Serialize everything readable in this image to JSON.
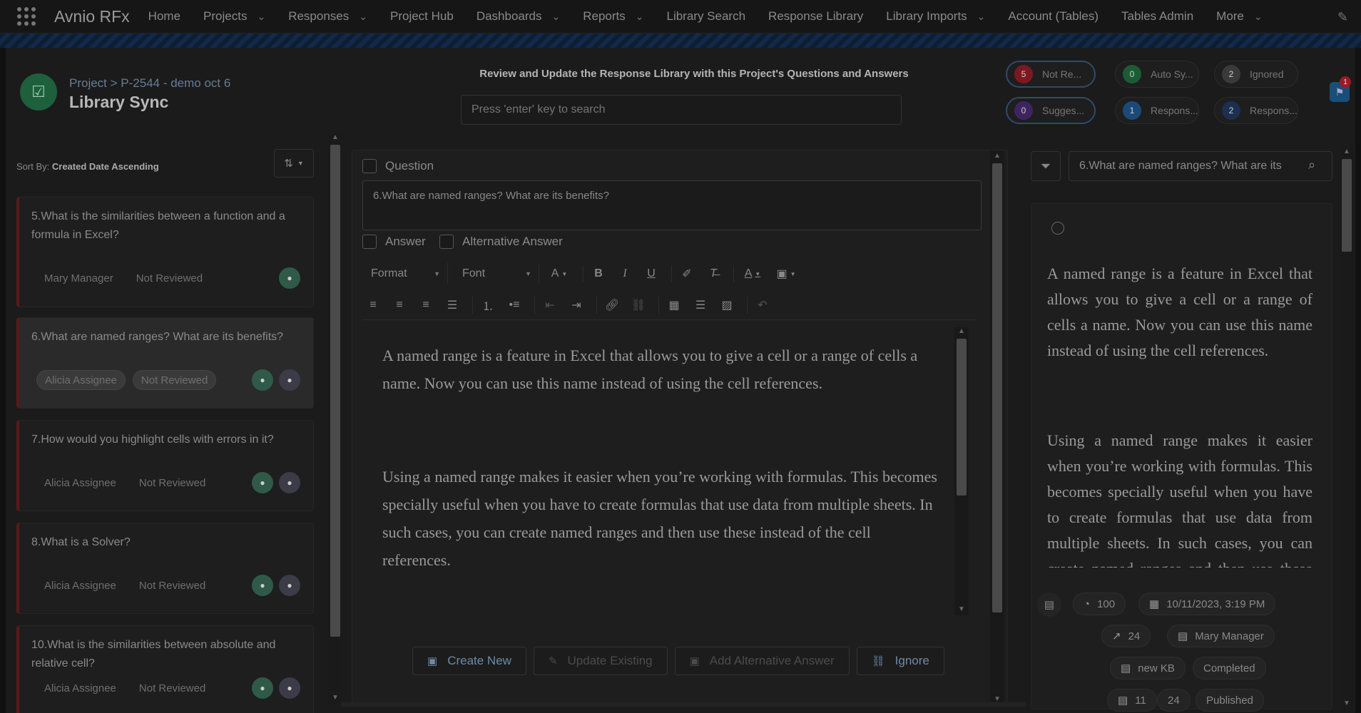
{
  "nav": {
    "app_name": "Avnio RFx",
    "items": [
      {
        "label": "Home",
        "dropdown": false
      },
      {
        "label": "Projects",
        "dropdown": true
      },
      {
        "label": "Responses",
        "dropdown": true
      },
      {
        "label": "Project Hub",
        "dropdown": false
      },
      {
        "label": "Dashboards",
        "dropdown": true
      },
      {
        "label": "Reports",
        "dropdown": true
      },
      {
        "label": "Library Search",
        "dropdown": false
      },
      {
        "label": "Response Library",
        "dropdown": false
      },
      {
        "label": "Library Imports",
        "dropdown": true
      },
      {
        "label": "Account (Tables)",
        "dropdown": false
      },
      {
        "label": "Tables Admin",
        "dropdown": false
      },
      {
        "label": "More",
        "dropdown": true
      }
    ]
  },
  "header": {
    "breadcrumb": "Project > P-2544 - demo oct 6",
    "title": "Library Sync",
    "center_title": "Review and Update the Response Library with this Project's Questions and Answers",
    "search_placeholder": "Press 'enter' key to search",
    "notification_count": "1"
  },
  "status_pills": [
    {
      "count": "5",
      "label": "Not Re...",
      "color": "#7a1a20",
      "active": true
    },
    {
      "count": "0",
      "label": "Auto Sy...",
      "color": "#1b5c34",
      "active": false
    },
    {
      "count": "2",
      "label": "Ignored",
      "color": "#3a3a3a",
      "active": false
    },
    {
      "count": "0",
      "label": "Sugges...",
      "color": "#3f2560",
      "active": true
    },
    {
      "count": "1",
      "label": "Respons...",
      "color": "#1b4a78",
      "active": false
    },
    {
      "count": "2",
      "label": "Respons...",
      "color": "#1b3050",
      "active": false
    }
  ],
  "left_panel": {
    "sort_prefix": "Sort By:",
    "sort_value": "Created Date Ascending",
    "questions": [
      {
        "text": "5.What is the similarities between a function and a formula in Excel?",
        "assignee": "Mary Manager",
        "status": "Not Reviewed",
        "avatars": [
          "f"
        ],
        "selected": false
      },
      {
        "text": "6.What are named ranges? What are its benefits?",
        "assignee": "Alicia Assignee",
        "status": "Not Reviewed",
        "avatars": [
          "f",
          "m"
        ],
        "selected": true
      },
      {
        "text": "7.How would you highlight cells with errors in it?",
        "assignee": "Alicia Assignee",
        "status": "Not Reviewed",
        "avatars": [
          "f",
          "m"
        ],
        "selected": false
      },
      {
        "text": "8.What is a Solver?",
        "assignee": "Alicia Assignee",
        "status": "Not Reviewed",
        "avatars": [
          "f",
          "m"
        ],
        "selected": false
      },
      {
        "text": "10.What is the similarities between absolute and relative cell?",
        "assignee": "Alicia Assignee",
        "status": "Not Reviewed",
        "avatars": [
          "f",
          "m"
        ],
        "selected": false
      }
    ]
  },
  "middle_panel": {
    "question_label": "Question",
    "question_text": "6.What are named ranges? What are its benefits?",
    "answer_label": "Answer",
    "alt_answer_label": "Alternative Answer",
    "format_label": "Format",
    "font_label": "Font",
    "answer_paragraphs": [
      "A named range is a feature in Excel that allows you to give a cell or a range of cells a name. Now you can use this name instead of using the cell references.",
      "Using a named range makes it easier when you’re working with formulas. This becomes specially useful when you have to create formulas that use data from multiple sheets. In such cases, you can create named ranges and then use these instead of the cell references."
    ],
    "buttons": {
      "create_new": "Create New",
      "update_existing": "Update Existing",
      "add_alternative": "Add Alternative Answer",
      "ignore": "Ignore"
    }
  },
  "right_panel": {
    "search_value": "6.What are named ranges? What are its",
    "paragraphs": [
      "A named range is a feature in Excel that allows you to give a cell or a range of cells a name. Now you can use this name instead of using the cell references.",
      "Using a named range makes it easier when you’re working with formulas. This becomes specially useful when you have to create formulas that use data from multiple sheets. In such cases, you can create named ranges and then use these instead of the cell references."
    ],
    "meta": {
      "score": "100",
      "date": "10/11/2023, 3:19 PM",
      "usage": "24",
      "owner": "Mary Manager",
      "library": "new KB",
      "state": "Completed",
      "count_a": "11",
      "count_b": "24",
      "publish": "Published"
    }
  }
}
